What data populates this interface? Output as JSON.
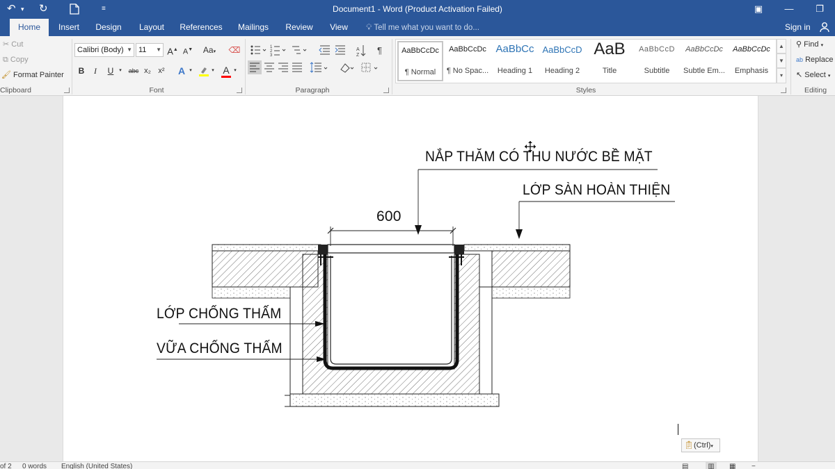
{
  "app": {
    "title": "Document1 - Word (Product Activation Failed)",
    "accent": "#2b579a"
  },
  "quick_access": {
    "undo_icon": "undo-icon",
    "redo_icon": "repeat-icon",
    "new_icon": "new-document-icon",
    "customize_icon": "customize-icon"
  },
  "tabs": [
    {
      "label": "Home",
      "active": true
    },
    {
      "label": "Insert"
    },
    {
      "label": "Design"
    },
    {
      "label": "Layout"
    },
    {
      "label": "References"
    },
    {
      "label": "Mailings"
    },
    {
      "label": "Review"
    },
    {
      "label": "View"
    }
  ],
  "tellme": {
    "placeholder": "Tell me what you want to do..."
  },
  "account": {
    "signin": "Sign in"
  },
  "clipboard": {
    "cut": "Cut",
    "copy": "Copy",
    "format_painter": "Format Painter",
    "group_label": "Clipboard"
  },
  "font": {
    "name": "Calibri (Body)",
    "size": "11",
    "grow": "A",
    "shrink": "A",
    "change_case": "Aa",
    "bold": "B",
    "italic": "I",
    "underline": "U",
    "strikethrough": "abc",
    "subscript": "x₂",
    "superscript": "x²",
    "font_color": "A",
    "group_label": "Font",
    "highlight_color": "#ffff00",
    "text_color": "#ff0000"
  },
  "paragraph": {
    "group_label": "Paragraph"
  },
  "styles": {
    "group_label": "Styles",
    "items": [
      {
        "preview": "AaBbCcDc",
        "name": "¶ Normal",
        "selected": true
      },
      {
        "preview": "AaBbCcDc",
        "name": "¶ No Spac..."
      },
      {
        "preview": "AaBbCc",
        "name": "Heading 1"
      },
      {
        "preview": "AaBbCcD",
        "name": "Heading 2"
      },
      {
        "preview": "AaB",
        "name": "Title"
      },
      {
        "preview": "AaBbCcD",
        "name": "Subtitle"
      },
      {
        "preview": "AaBbCcDc",
        "name": "Subtle Em..."
      },
      {
        "preview": "AaBbCcDc",
        "name": "Emphasis"
      }
    ]
  },
  "editing": {
    "find": "Find",
    "replace": "Replace",
    "select": "Select",
    "group_label": "Editing"
  },
  "drawing": {
    "label_cover": "NẮP THĂM CÓ THU NƯỚC BỀ MẶT",
    "label_floor": "LỚP SÀN HOÀN THIỆN",
    "label_membrane": "LỚP CHỐNG THẤM",
    "label_mortar": "VỮA CHỐNG THẤM",
    "dimension": "600"
  },
  "paste_options": {
    "label": "(Ctrl)"
  },
  "status": {
    "page": "of 2",
    "words": "0 words",
    "language": "English (United States)"
  }
}
